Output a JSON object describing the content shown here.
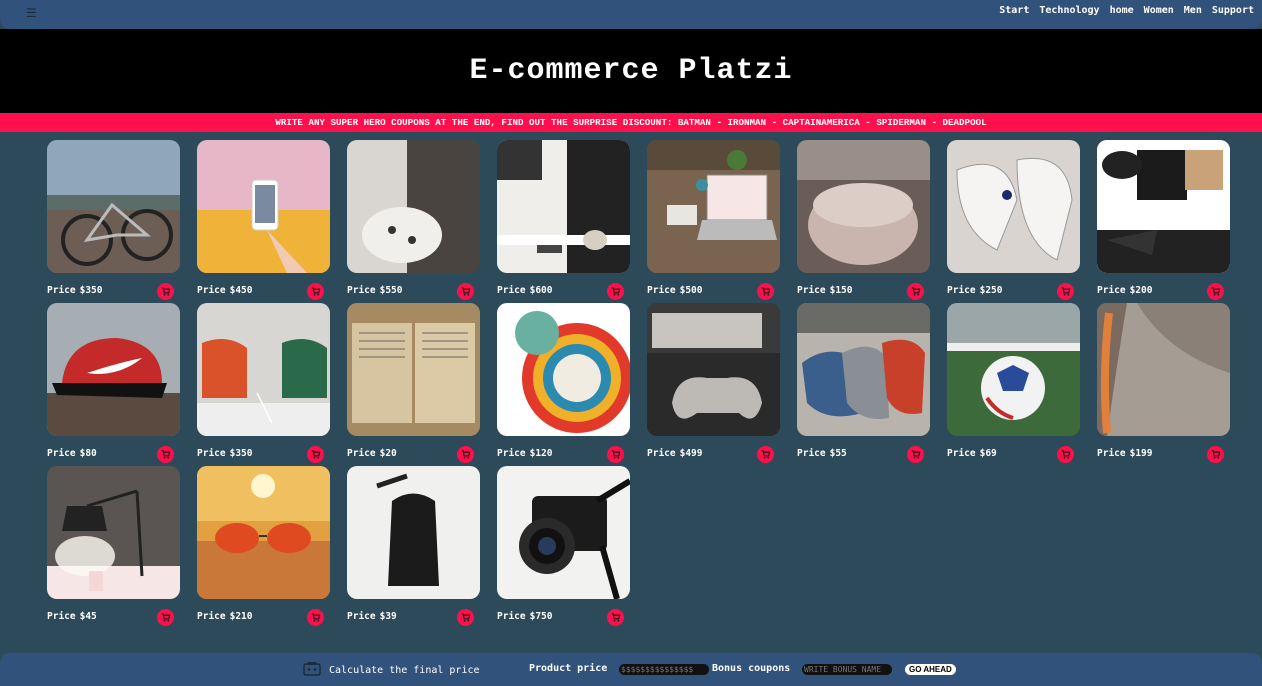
{
  "header": {
    "menu_icon": "hamburger-icon",
    "nav": [
      "Start",
      "Technology",
      "home",
      "Women",
      "Men",
      "Support"
    ]
  },
  "hero": {
    "title": "E-commerce Platzi"
  },
  "banner": {
    "text": "WRITE ANY SUPER HERO COUPONS AT THE END, FIND OUT THE SURPRISE DISCOUNT: BATMAN - IRONMAN - CAPTAINAMERICA - SPIDERMAN - DEADPOOL"
  },
  "products": [
    {
      "image": "bicycle",
      "label": "Price",
      "price": "$350"
    },
    {
      "image": "smartphone",
      "label": "Price",
      "price": "$450"
    },
    {
      "image": "game-controller-white",
      "label": "Price",
      "price": "$550"
    },
    {
      "image": "tv-room",
      "label": "Price",
      "price": "$600"
    },
    {
      "image": "laptop-desk",
      "label": "Price",
      "price": "$500"
    },
    {
      "image": "smart-speaker",
      "label": "Price",
      "price": "$150"
    },
    {
      "image": "white-sneakers",
      "label": "Price",
      "price": "$250"
    },
    {
      "image": "nike-outfit",
      "label": "Price",
      "price": "$200"
    },
    {
      "image": "nike-cap",
      "label": "Price",
      "price": "$80"
    },
    {
      "image": "armchairs",
      "label": "Price",
      "price": "$350"
    },
    {
      "image": "old-book",
      "label": "Price",
      "price": "$20"
    },
    {
      "image": "colorful-plates",
      "label": "Price",
      "price": "$120"
    },
    {
      "image": "playstation",
      "label": "Price",
      "price": "$499"
    },
    {
      "image": "loafers",
      "label": "Price",
      "price": "$55"
    },
    {
      "image": "soccer-ball",
      "label": "Price",
      "price": "$69"
    },
    {
      "image": "skateboard",
      "label": "Price",
      "price": "$199"
    },
    {
      "image": "desk-lamp",
      "label": "Price",
      "price": "$45"
    },
    {
      "image": "sunglasses",
      "label": "Price",
      "price": "$210"
    },
    {
      "image": "backpack",
      "label": "Price",
      "price": "$39"
    },
    {
      "image": "camera",
      "label": "Price",
      "price": "$750"
    }
  ],
  "footer": {
    "calc_label": "Calculate the final price",
    "product_price_label": "Product price",
    "product_price_placeholder": "$$$$$$$$$$$$$$$",
    "bonus_label": "Bonus coupons",
    "bonus_placeholder": "WRITE BONUS NAME",
    "go_label": "GO AHEAD"
  },
  "colors": {
    "accent": "#ff0f4b",
    "bar": "#31527a",
    "background": "#2d4a5a"
  }
}
